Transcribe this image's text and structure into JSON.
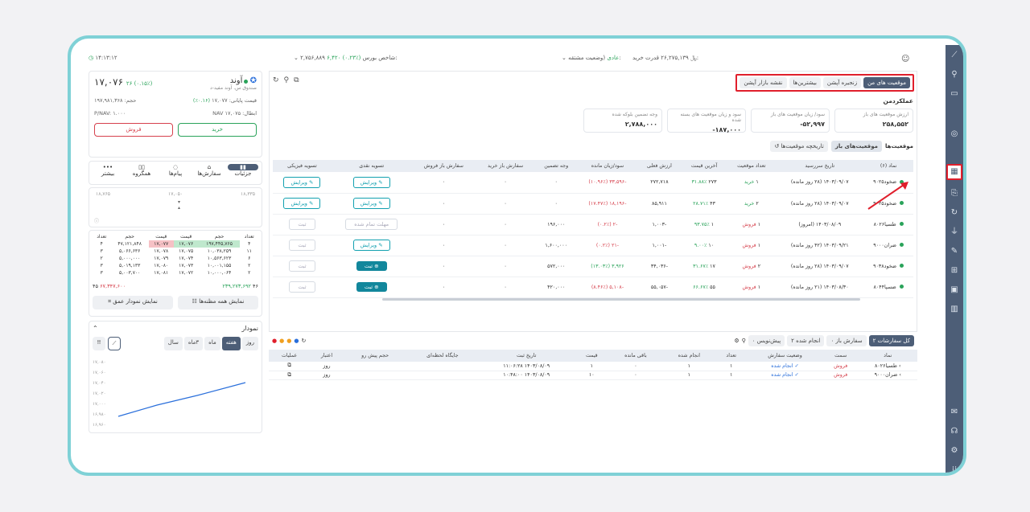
{
  "topbar": {
    "time": "۱۴:۱۳:۱۲",
    "index_label": "شاخص بورس:",
    "index_value": "۲,۷۵۶,۸۸۹",
    "index_change": "۶,۴۲۰ (۰.۲۳٪)",
    "status_label": "(وضعیت مشتقه:",
    "status_value": "عادی",
    "buy_power_label": "قدرت خرید:",
    "buy_power_value": "۲۶,۲۷۵,۱۳۹",
    "currency": "﷼"
  },
  "symbol": {
    "name": "آوند",
    "fund": "صندوق س. آوند مفید-د",
    "price": "۱۷,۰۷۶",
    "change": "۲۶ (۰.۱۵٪)",
    "final_label": "قیمت پایانی:",
    "final_value": "۱۷,۰۷۷",
    "final_change": "(۰.۱۶٪)",
    "volume_label": "حجم:",
    "volume_value": "۱۹۷,۹۸۱,۳۶۸",
    "nav_label": "NAV ابطال:",
    "nav_value": "۱۷,۰۷۵",
    "pnav_label": "P/NAV:",
    "pnav_value": "۱.۰۰۰",
    "buy": "خرید",
    "sell": "فروش"
  },
  "left_tabs": [
    "جزئیات",
    "سفارش‌ها",
    "پیام‌ها",
    "همگروه",
    "بیشتر"
  ],
  "range": {
    "low": "۱۸,۷۶۵",
    "mid": "۱۷,۰۵۰",
    "high": "۱۸,۳۳۵"
  },
  "orderbook": {
    "headers": [
      "تعداد",
      "حجم",
      "قیمت",
      "قیمت",
      "حجم",
      "تعداد"
    ],
    "rows": [
      [
        "۴",
        "۱۹۷,۴۴۵,۷۶۵",
        "۱۷,۰۷۶",
        "۱۷,۰۷۷",
        "۴۷,۱۲۱,۸۴۸",
        "۴"
      ],
      [
        "۱۱",
        "۱۰,۰۳۸,۲۵۹",
        "۱۷,۰۷۵",
        "۱۷,۰۷۸",
        "۵,۰۶۶,۶۳۶",
        "۳"
      ],
      [
        "۶",
        "۱۰,۵۶۳,۶۲۳",
        "۱۷,۰۷۴",
        "۱۷,۰۷۹",
        "۵,۰۰۰,۰۰۰",
        "۲"
      ],
      [
        "۲",
        "۱۰,۰۰۱,۱۵۵",
        "۱۷,۰۷۳",
        "۱۷,۰۸۰",
        "۵,۰۱۹,۱۳۳",
        "۳"
      ],
      [
        "۲",
        "۱۰,۰۰۰,۰۶۴",
        "۱۷,۰۷۲",
        "۱۷,۰۸۱",
        "۵,۰۰۳,۷۰۰",
        "۳"
      ]
    ],
    "total_left": "۴۶",
    "total_left_vol": "۲۳۹,۲۷۳,۶۹۲",
    "total_right": "۴۵",
    "total_right_vol": "۶۷,۳۴۷,۶۰۰",
    "show_all": "نمایش همه مظنه‌ها",
    "show_depth": "نمایش نمودار عمق"
  },
  "chart_panel": {
    "title": "نمودار",
    "ranges": [
      "روز",
      "هفته",
      "ماه",
      "۳ماه",
      "سال"
    ],
    "selected": "هفته",
    "yticks": [
      "۱۷,۰۸۰",
      "۱۷,۰۶۰",
      "۱۷,۰۴۰",
      "۱۷,۰۲۰",
      "۱۷,۰۰۰",
      "۱۶,۹۸۰",
      "۱۶,۹۶۰"
    ]
  },
  "main": {
    "tabs": [
      "موقعیت های من",
      "زنجیره آپشن",
      "بیشترین‌ها",
      "نقشه بازار آپشن"
    ],
    "perf_title": "عملکردمن",
    "stats": [
      {
        "label": "ارزش موقعیت های باز",
        "value": "۲۵۸,۵۵۲"
      },
      {
        "label": "سود/ زیان موقعیت های باز",
        "value": "-۵۲,۹۹۷"
      },
      {
        "label": "سود و زیان موقعیت های بسته شده",
        "value": "-۱۸۷,۰۰۰"
      },
      {
        "label": "وجه تضمین بلوکه شده",
        "value": "۲,۷۸۸,۰۰۰"
      }
    ],
    "sub_tabs": [
      "موقعیت‌ها",
      "موقعیت‌های باز",
      "تاریخچه موقعیت‌ها"
    ],
    "headers": [
      "نماد (۶)",
      "تاریخ سررسید",
      "تعداد موقعیت",
      "آخرین قیمت",
      "ارزش فعلی",
      "سود/زیان مانده",
      "وجه تضمین",
      "سفارش باز خرید",
      "سفارش باز فروش",
      "تسویه نقدی",
      "تسویه فیزیکی"
    ],
    "rows": [
      {
        "sym": "ضخود۹۰۲۵",
        "date": "۱۴۰۳/۰۹/۰۷ (۲۸ روز مانده)",
        "qty": "۱",
        "side": "خرید",
        "last": "۲۷۳",
        "lastp": "۳۱.۸۸٪",
        "val": "۲۷۲,۷۱۸",
        "pl": "-۳۳,۵۹۶ (۱۰.۹۶٪)",
        "margin": "۰",
        "ob": "۰",
        "os": "۰",
        "cash": "ویرایش",
        "phys": "ویرایش",
        "cashType": "edit",
        "physType": "edit"
      },
      {
        "sym": "ضخود۹۰۲۵",
        "date": "۱۴۰۳/۰۹/۰۷ (۲۸ روز مانده)",
        "qty": "۲",
        "side": "خرید",
        "last": "۴۳",
        "lastp": "۲۸.۷۱٪",
        "val": "۸۵,۹۱۱",
        "pl": "-۱۸,۱۹۶ (۱۷.۴۷٪)",
        "margin": "۰",
        "ob": "۰",
        "os": "۰",
        "cash": "ویرایش",
        "phys": "ویرایش",
        "cashType": "edit",
        "physType": "edit"
      },
      {
        "sym": "طسیا۸۰۲۶",
        "date": "۱۴۰۳/۰۸/۰۹ (امروز)",
        "qty": "۱",
        "side": "فروش",
        "last": "۱",
        "lastp": "۹۳.۷۵٪",
        "val": "-۱,۰۰۳",
        "pl": "-۲ (۰.۲٪)",
        "margin": "۱۹۶,۰۰۰",
        "ob": "۰",
        "os": "۰",
        "cash": "مهلت تمام شده",
        "phys": "ثبت",
        "cashType": "dis",
        "physType": "dis"
      },
      {
        "sym": "ضران۹۰۰۰",
        "date": "۱۴۰۳/۰۹/۲۱ (۴۲ روز مانده)",
        "qty": "۱",
        "side": "فروش",
        "last": "۱۰",
        "lastp": "۹.۰۰٪",
        "val": "-۱,۰۰۱",
        "pl": "-۲۱ (۰.۲٪)",
        "margin": "۱,۶۰۰,۰۰۰",
        "ob": "۰",
        "os": "۰",
        "cash": "ویرایش",
        "phys": "ثبت",
        "cashType": "edit",
        "physType": "dis"
      },
      {
        "sym": "ضخود۹۰۳۸",
        "date": "۱۴۰۳/۰۹/۰۷ (۲۸ روز مانده)",
        "qty": "۲",
        "side": "فروش",
        "last": "۱۷",
        "lastp": "۳۱.۶۷٪",
        "val": "-۳۴,۰۳۶",
        "pl": "۳,۹۲۶ (۱۳.۰۳٪)",
        "margin": "۵۷۲,۰۰۰",
        "ob": "۰",
        "os": "۰",
        "cash": "ثبت",
        "phys": "ثبت",
        "cashType": "sub",
        "physType": "dis"
      },
      {
        "sym": "ضسپا۸۰۴۴",
        "date": "۱۴۰۳/۰۸/۳۰ (۲۱ روز مانده)",
        "qty": "۱",
        "side": "فروش",
        "last": "۵۵",
        "lastp": "۶۶.۶۷٪",
        "val": "-۵۵,۰۵۷",
        "pl": "-۵,۱۰۸ (۸.۴۶٪)",
        "margin": "۴۲۰,۰۰۰",
        "ob": "۰",
        "os": "۰",
        "cash": "ثبت",
        "phys": "ثبت",
        "cashType": "sub",
        "physType": "dis"
      }
    ]
  },
  "orders": {
    "tabs": [
      "کل سفارشات",
      "سفارش باز",
      "انجام شده",
      "پیش‌نویس"
    ],
    "tab_counts": [
      "۲",
      "۰",
      "۲",
      "۰"
    ],
    "headers": [
      "نماد",
      "سمت",
      "وضعیت سفارش",
      "تعداد",
      "انجام شده",
      "باقی مانده",
      "قیمت",
      "تاریخ ثبت",
      "جایگاه لحظه‌ای",
      "حجم پیش رو",
      "اعتبار",
      "عملیات"
    ],
    "rows": [
      {
        "sym": "طسیا۸۰۲۶",
        "side": "فروش",
        "status": "انجام شده",
        "qty": "۱",
        "done": "۱",
        "rem": "۰",
        "price": "۱",
        "date": "۱۴۰۳/۰۸/۰۹ ۱۱:۰۶:۲۸",
        "valid": "روز"
      },
      {
        "sym": "ضران۹۰۰۰",
        "side": "فروش",
        "status": "انجام شده",
        "qty": "۱",
        "done": "۱",
        "rem": "۰",
        "price": "۱۰",
        "date": "۱۴۰۳/۰۸/۰۹ ۱۰:۴۸:۰۰",
        "valid": "روز"
      }
    ]
  },
  "colors": {
    "accent": "#12a0b0",
    "rail": "#4d5e77",
    "red": "#d6414d",
    "green": "#2aa35a",
    "frame": "#7fd1d6"
  }
}
